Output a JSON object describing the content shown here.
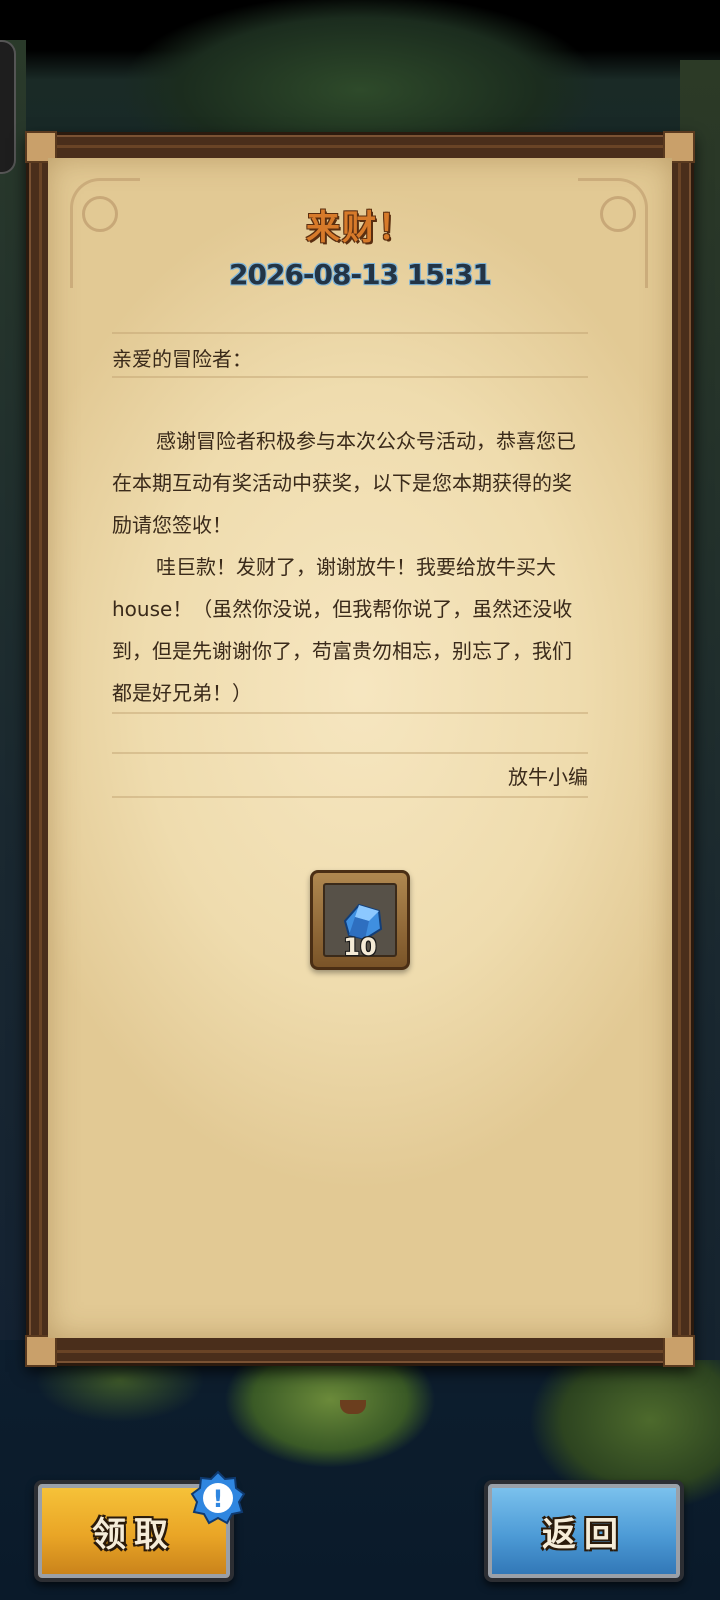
{
  "mail": {
    "title": "来财！",
    "date": "2026-08-13 15:31",
    "salutation": "亲爱的冒险者：",
    "paragraph_1": "感谢冒险者积极参与本次公众号活动，恭喜您已在本期互动有奖活动中获奖，以下是您本期获得的奖励请您签收！",
    "paragraph_2": "哇巨款！发财了，谢谢放牛！我要给放牛买大house！（虽然你没说，但我帮你说了，虽然还没收到，但是先谢谢你了，苟富贵勿相忘，别忘了，我们都是好兄弟！）",
    "signature": "放牛小编"
  },
  "reward": {
    "icon": "blue-crystal-icon",
    "count": "10",
    "color": "#3f8fe0"
  },
  "buttons": {
    "claim_label": "领取",
    "claim_badge": "!",
    "back_label": "返回"
  },
  "colors": {
    "title": "#d77a2a",
    "claim_button": "#e9a526",
    "back_button": "#4d9bd6",
    "badge": "#2f86e0"
  }
}
